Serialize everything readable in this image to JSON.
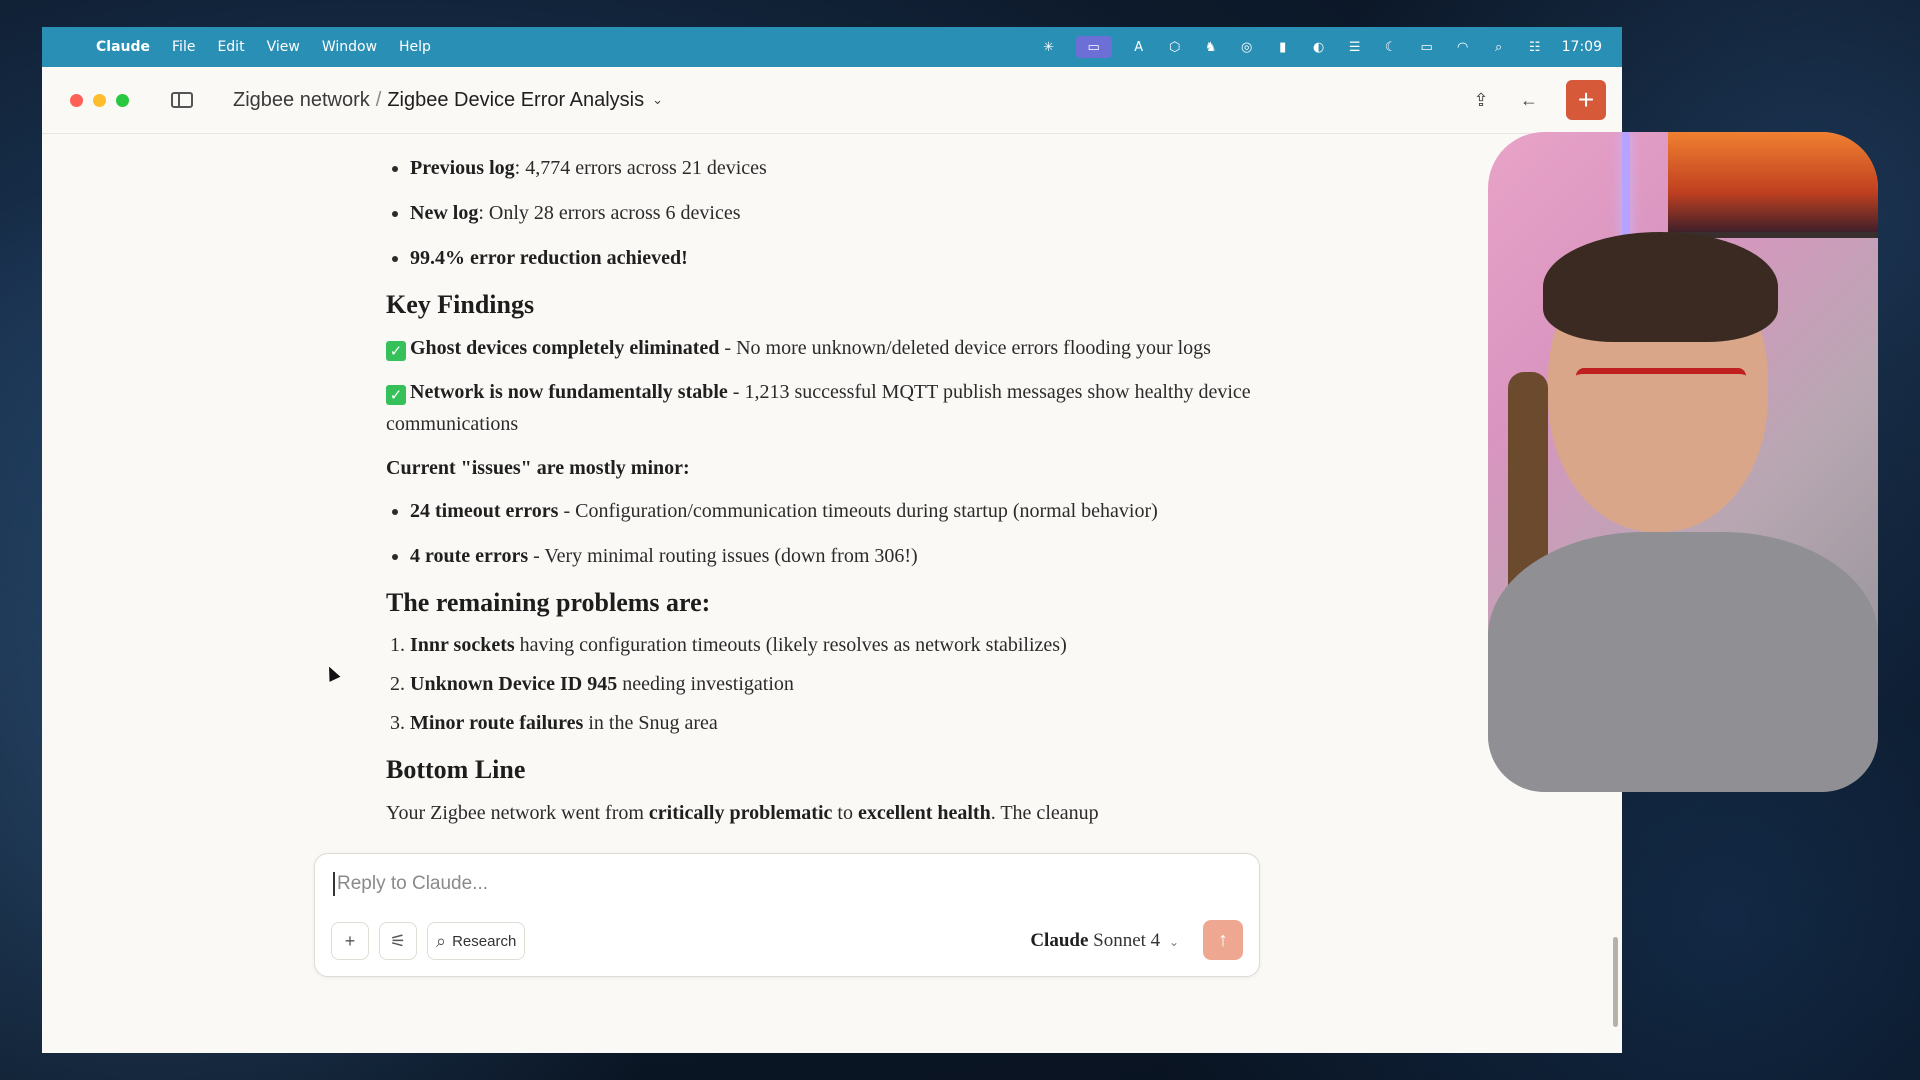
{
  "menubar": {
    "app_name": "Claude",
    "menus": [
      "File",
      "Edit",
      "View",
      "Window",
      "Help"
    ],
    "clock": "17:09"
  },
  "window": {
    "breadcrumb_project": "Zigbee network",
    "breadcrumb_separator": "/",
    "breadcrumb_chat": "Zigbee Device Error Analysis"
  },
  "content": {
    "summary": [
      {
        "bold": "Previous log",
        "text": ": 4,774 errors across 21 devices"
      },
      {
        "bold": "New log",
        "text": ": Only 28 errors across 6 devices"
      },
      {
        "bold": "99.4% error reduction achieved!",
        "text": ""
      }
    ],
    "key_findings_heading": "Key Findings",
    "findings": [
      {
        "bold": "Ghost devices completely eliminated",
        "text": " - No more unknown/deleted device errors flooding your logs"
      },
      {
        "bold": "Network is now fundamentally stable",
        "text": " - 1,213 successful MQTT publish messages show healthy device communications"
      }
    ],
    "minor_heading": "Current \"issues\" are mostly minor:",
    "minor_issues": [
      {
        "bold": "24 timeout errors",
        "text": " - Configuration/communication timeouts during startup (normal behavior)"
      },
      {
        "bold": "4 route errors",
        "text": " - Very minimal routing issues (down from 306!)"
      }
    ],
    "remaining_heading": "The remaining problems are:",
    "remaining": [
      {
        "bold": "Innr sockets",
        "text": " having configuration timeouts (likely resolves as network stabilizes)"
      },
      {
        "bold": "Unknown Device ID 945",
        "text": " needing investigation"
      },
      {
        "bold": "Minor route failures",
        "text": " in the Snug area"
      }
    ],
    "bottom_heading": "Bottom Line",
    "bottom_pre": "Your Zigbee network went from ",
    "bottom_b1": "critically problematic",
    "bottom_mid": " to ",
    "bottom_b2": "excellent health",
    "bottom_post": ". The cleanup"
  },
  "reply": {
    "placeholder": "Reply to Claude...",
    "research_label": "Research",
    "model_name": "Claude",
    "model_version": "Sonnet 4"
  }
}
